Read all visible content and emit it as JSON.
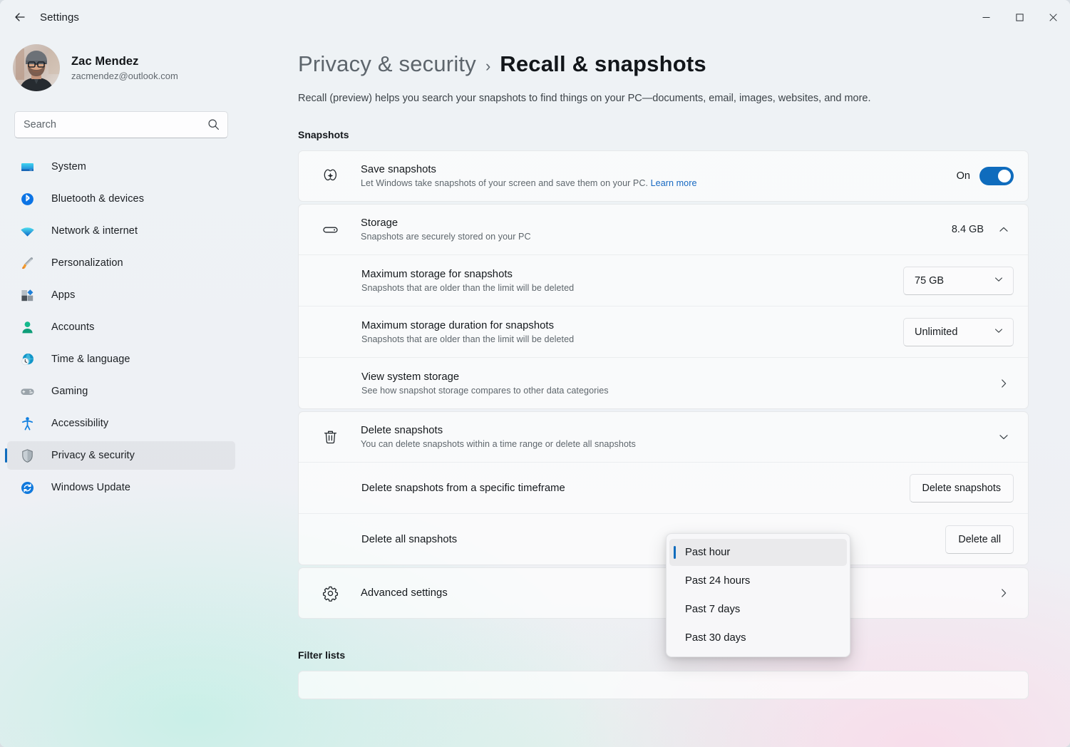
{
  "window": {
    "title": "Settings",
    "back_icon": "back-arrow-icon",
    "minimize_label": "−",
    "maximize_label": "□",
    "close_label": "✕"
  },
  "accent_color": "#0f6cbd",
  "profile": {
    "name": "Zac Mendez",
    "email": "zacmendez@outlook.com"
  },
  "search": {
    "placeholder": "Search",
    "value": "",
    "icon": "search-icon"
  },
  "sidebar": {
    "items": [
      {
        "label": "System",
        "icon": "monitor-icon",
        "active": false
      },
      {
        "label": "Bluetooth & devices",
        "icon": "bluetooth-icon",
        "active": false
      },
      {
        "label": "Network & internet",
        "icon": "wifi-icon",
        "active": false
      },
      {
        "label": "Personalization",
        "icon": "paintbrush-icon",
        "active": false
      },
      {
        "label": "Apps",
        "icon": "apps-icon",
        "active": false
      },
      {
        "label": "Accounts",
        "icon": "person-icon",
        "active": false
      },
      {
        "label": "Time & language",
        "icon": "clock-globe-icon",
        "active": false
      },
      {
        "label": "Gaming",
        "icon": "gamepad-icon",
        "active": false
      },
      {
        "label": "Accessibility",
        "icon": "accessibility-icon",
        "active": false
      },
      {
        "label": "Privacy & security",
        "icon": "shield-icon",
        "active": true
      },
      {
        "label": "Windows Update",
        "icon": "update-icon",
        "active": false
      }
    ]
  },
  "breadcrumb": {
    "parent": "Privacy & security",
    "separator": "›",
    "current": "Recall & snapshots"
  },
  "page": {
    "description": "Recall (preview) helps you search your snapshots to find things on your PC—documents, email, images, websites, and more."
  },
  "sections": {
    "snapshots_heading": "Snapshots",
    "filter_lists_heading": "Filter lists"
  },
  "save_snapshots": {
    "icon": "recall-icon",
    "title": "Save snapshots",
    "subtitle": "Let Windows take snapshots of your screen and save them on your PC.",
    "link_text": "Learn more",
    "toggle_state_label": "On",
    "toggle_on": true
  },
  "storage": {
    "icon": "drive-icon",
    "title": "Storage",
    "subtitle": "Snapshots are securely stored on your PC",
    "value": "8.4 GB",
    "expand_icon": "chevron-up-icon",
    "expanded": true,
    "rows": [
      {
        "title": "Maximum storage for snapshots",
        "subtitle": "Snapshots that are older than the limit will be deleted",
        "control": "combobox",
        "value": "75 GB",
        "chevron": "chevron-down-icon"
      },
      {
        "title": "Maximum storage duration for snapshots",
        "subtitle": "Snapshots that are older than the limit will be deleted",
        "control": "combobox",
        "value": "Unlimited",
        "chevron": "chevron-down-icon"
      },
      {
        "title": "View system storage",
        "subtitle": "See how snapshot storage compares to other data categories",
        "control": "navigate",
        "value": "",
        "chevron": "chevron-right-icon"
      }
    ]
  },
  "delete_snapshots": {
    "icon": "trash-icon",
    "title": "Delete snapshots",
    "subtitle": "You can delete snapshots within a time range or delete all snapshots",
    "expand_icon": "chevron-down-icon",
    "expanded": true,
    "timeframe_row": {
      "title": "Delete snapshots from a specific timeframe",
      "button_label": "Delete snapshots"
    },
    "delete_all_row": {
      "title": "Delete all snapshots",
      "button_label": "Delete all"
    }
  },
  "timeframe_flyout": {
    "open": true,
    "selected": "Past hour",
    "options": [
      "Past hour",
      "Past 24 hours",
      "Past 7 days",
      "Past 30 days"
    ]
  },
  "advanced_settings": {
    "icon": "gear-icon",
    "title": "Advanced settings",
    "chevron": "chevron-right-icon"
  }
}
